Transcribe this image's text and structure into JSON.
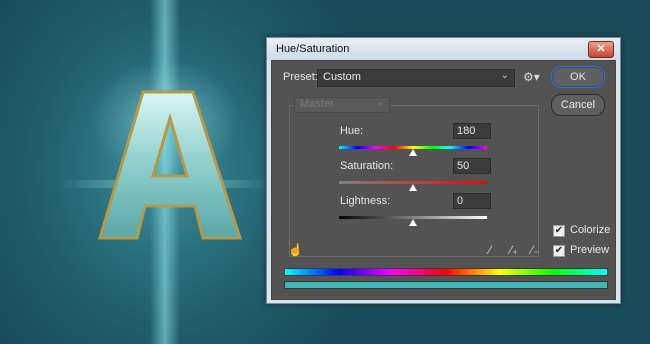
{
  "dialog": {
    "title": "Hue/Saturation",
    "close_label": "✕"
  },
  "preset": {
    "label": "Preset:",
    "value": "Custom"
  },
  "buttons": {
    "ok": "OK",
    "cancel": "Cancel"
  },
  "channel": {
    "value": "Master"
  },
  "sliders": {
    "hue": {
      "label": "Hue:",
      "value": "180",
      "fraction": 0.5
    },
    "saturation": {
      "label": "Saturation:",
      "value": "50",
      "fraction": 0.5
    },
    "lightness": {
      "label": "Lightness:",
      "value": "0",
      "fraction": 0.5
    }
  },
  "options": {
    "colorize": {
      "label": "Colorize",
      "checked": true
    },
    "preview": {
      "label": "Preview",
      "checked": true
    }
  },
  "icons": [
    "hand-target-icon",
    "eyedropper-icon",
    "eyedropper-plus-icon",
    "eyedropper-minus-icon",
    "gear-icon",
    "chevron-down-icon"
  ],
  "colors": {
    "dialog_body": "#535353",
    "ok_ring": "#3a6fc2",
    "result_bar": "#3fb8b8"
  }
}
